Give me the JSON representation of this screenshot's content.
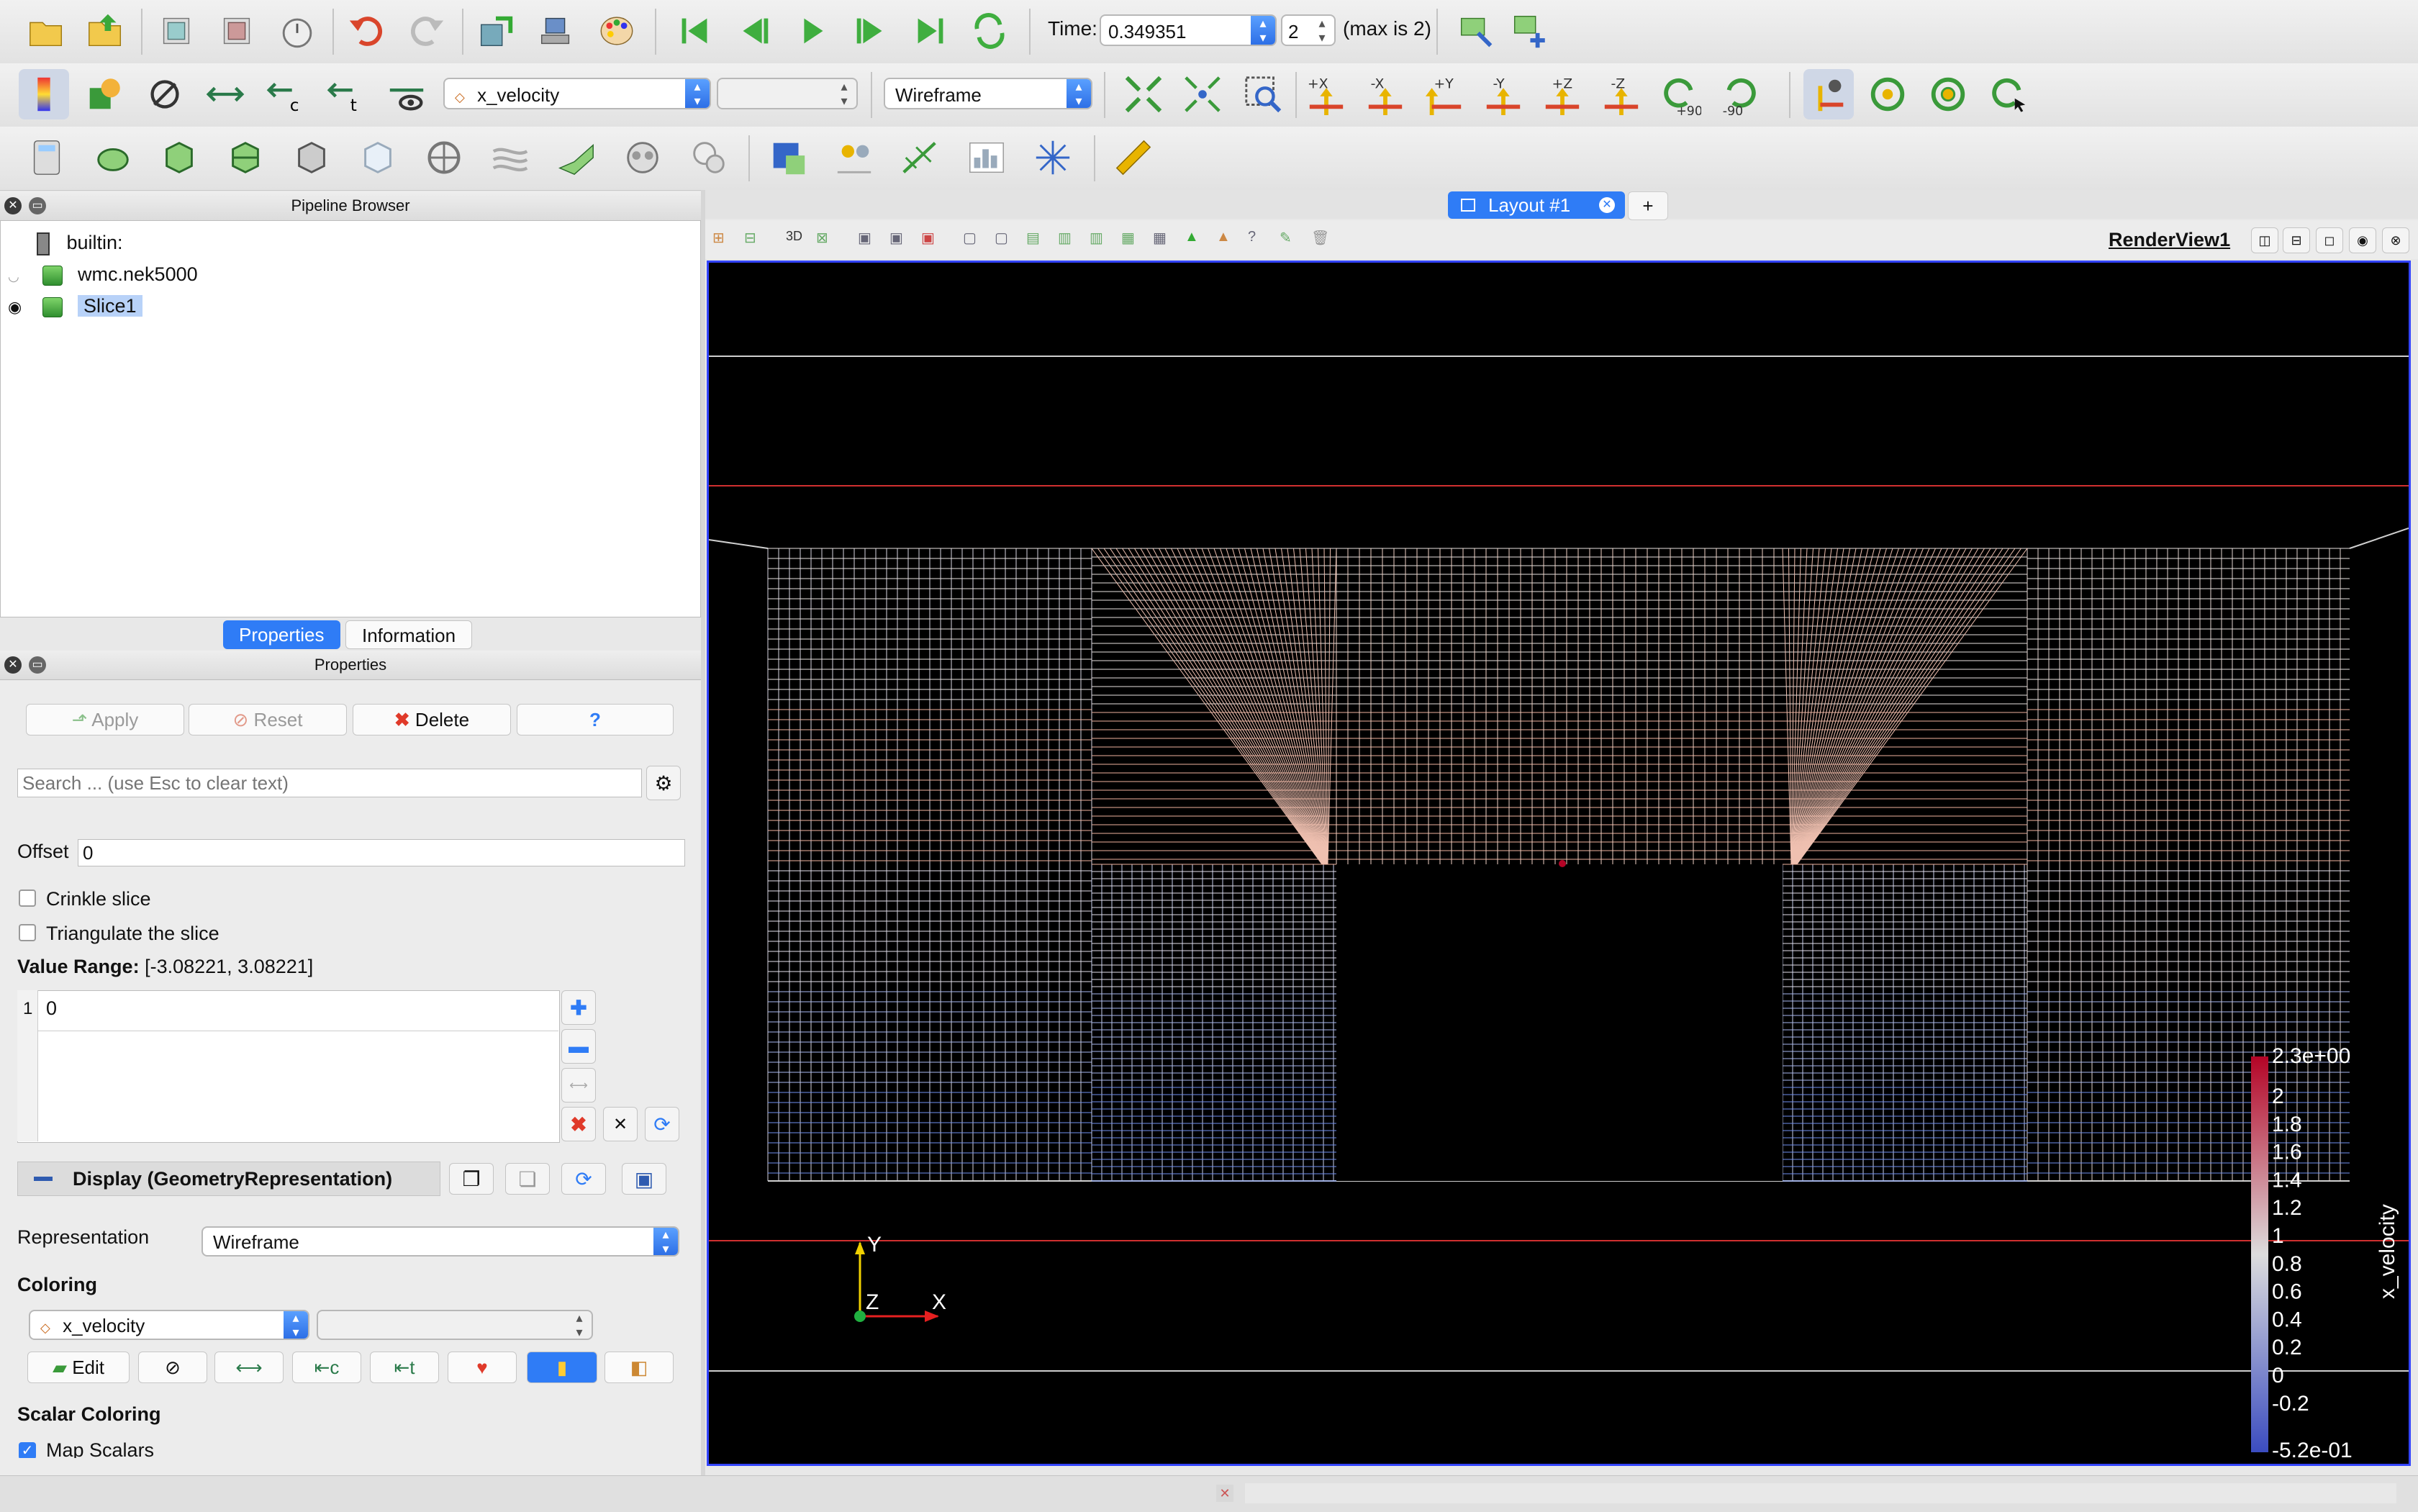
{
  "toolbar_time": {
    "time_label": "Time:",
    "time_value": "0.349351",
    "timestep_value": "2",
    "max_label": "(max is 2)"
  },
  "toolbar_color": {
    "array_selected": "x_velocity",
    "component_selected": "",
    "representation_selected": "Wireframe",
    "view_labels": [
      "+X",
      "-X",
      "+Y",
      "-Y",
      "+Z",
      "-Z"
    ],
    "rotate_plus": "+90",
    "rotate_minus": "-90"
  },
  "pipeline": {
    "title": "Pipeline Browser",
    "items": [
      {
        "label": "builtin:"
      },
      {
        "label": "wmc.nek5000"
      },
      {
        "label": "Slice1"
      }
    ]
  },
  "tabs": {
    "properties": "Properties",
    "information": "Information"
  },
  "properties": {
    "title": "Properties",
    "apply": "Apply",
    "reset": "Reset",
    "delete": "Delete",
    "help": "?",
    "search_placeholder": "Search ... (use Esc to clear text)",
    "offset_label": "Offset",
    "offset_value": "0",
    "crinkle_label": "Crinkle slice",
    "triangulate_label": "Triangulate the slice",
    "value_range_label": "Value Range:",
    "value_range": "[-3.08221, 3.08221]",
    "slice_index": "1",
    "slice_value": "0",
    "display_label": "Display (GeometryRepresentation)",
    "representation_label": "Representation",
    "representation_value": "Wireframe",
    "coloring_label": "Coloring",
    "coloring_array": "x_velocity",
    "coloring_component": "",
    "edit_label": "Edit",
    "scalar_coloring_label": "Scalar Coloring",
    "map_scalars_label": "Map Scalars"
  },
  "layout": {
    "tab_label": "Layout #1",
    "add_tab": "+",
    "view_name": "RenderView1",
    "view_3d_label": "3D"
  },
  "colorbar": {
    "title": "x_velocity",
    "ticks": [
      "2.3e+00",
      "2",
      "1.8",
      "1.6",
      "1.4",
      "1.2",
      "1",
      "0.8",
      "0.6",
      "0.4",
      "0.2",
      "0",
      "-0.2",
      "-5.2e-01"
    ],
    "colors": {
      "max": "#b40426",
      "mid": "#dddddd",
      "min": "#3b4cc0"
    }
  },
  "axes": {
    "x": "X",
    "y": "Y",
    "z": "Z",
    "colors": {
      "x": "#e62020",
      "y": "#f0d000",
      "z": "#20b040"
    }
  },
  "colors": {
    "accent": "#2f7cf6",
    "viewport_border": "#3344ff",
    "viewport_bg": "#000000"
  }
}
